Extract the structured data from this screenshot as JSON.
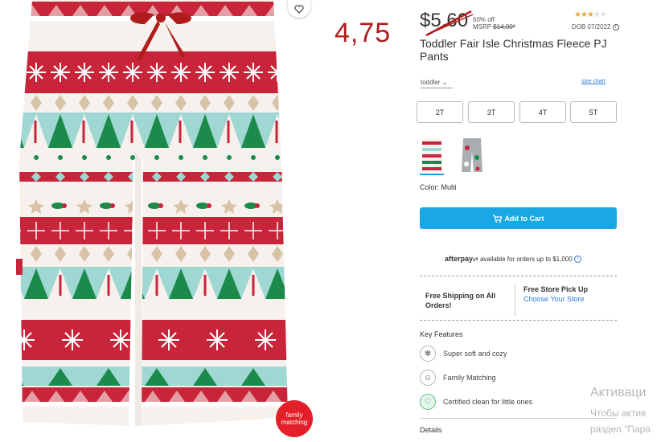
{
  "image_overlay": {
    "handwritten_price": "4,75",
    "badge": [
      "family",
      "matching"
    ],
    "favorite_icon": "heart-icon"
  },
  "price": {
    "sale": "$5.60",
    "pct_off": "60% off",
    "msrp_label": "MSRP",
    "msrp_value": "$14.00*",
    "rating_stars": 3,
    "rating_max": 5,
    "dob": "DOB 07/2022"
  },
  "product": {
    "title": "Toddler Fair Isle Christmas Fleece PJ Pants"
  },
  "size": {
    "range": "toddler",
    "chart_link": "size chart",
    "options": [
      "2T",
      "3T",
      "4T",
      "5T"
    ]
  },
  "color": {
    "label": "Color: Multi"
  },
  "actions": {
    "add_to_cart": "Add to Cart",
    "cart_icon": "cart-icon"
  },
  "afterpay": {
    "brand": "afterpay",
    "text": "available for orders up to $1,000"
  },
  "shipping": {
    "left": "Free Shipping on All Orders!",
    "right_title": "Free Store Pick Up",
    "right_link": "Choose Your Store"
  },
  "features": {
    "title": "Key Features",
    "items": [
      {
        "icon": "snowflake-icon",
        "label": "Super soft and cozy"
      },
      {
        "icon": "family-icon",
        "label": "Family Matching"
      },
      {
        "icon": "certified-icon",
        "label": "Certified clean for little ones"
      }
    ]
  },
  "details": {
    "label": "Details"
  },
  "os_watermark": {
    "line1": "Активаци",
    "line2": "Чтобы актив",
    "line3": "раздел \"Пара"
  },
  "colors": {
    "red": "#c8243a",
    "green": "#1b8a4a",
    "mint": "#9fd7d3",
    "tan": "#d9c3a8",
    "accent": "#1aa8e5"
  }
}
